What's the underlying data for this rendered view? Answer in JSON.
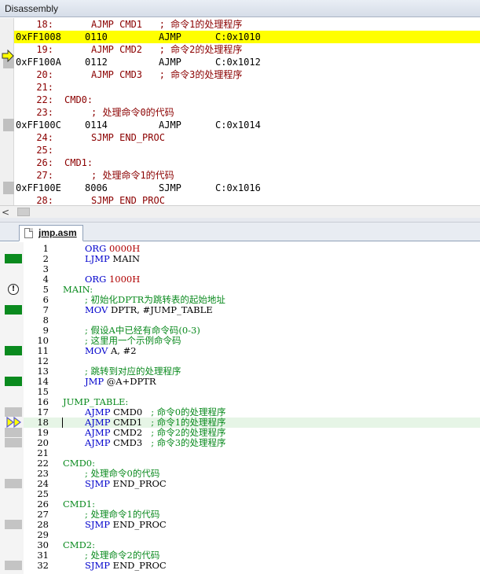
{
  "disassembly": {
    "title": "Disassembly",
    "lines": [
      {
        "kind": "src",
        "line": "18:",
        "text": "AJMP CMD1   ; 命令1的处理程序"
      },
      {
        "kind": "asm",
        "current": true,
        "addr": "0xFF1008",
        "opcode": "0110",
        "mnemonic": "AJMP",
        "operand": "C:0x1010"
      },
      {
        "kind": "src",
        "line": "19:",
        "text": "AJMP CMD2   ; 命令2的处理程序"
      },
      {
        "kind": "asm",
        "addr": "0xFF100A",
        "opcode": "0112",
        "mnemonic": "AJMP",
        "operand": "C:0x1012"
      },
      {
        "kind": "src",
        "line": "20:",
        "text": "AJMP CMD3   ; 命令3的处理程序"
      },
      {
        "kind": "src",
        "line": "21:",
        "text": ""
      },
      {
        "kind": "src",
        "line": "22:",
        "text": "CMD0:",
        "label": true
      },
      {
        "kind": "src",
        "line": "23:",
        "text": "; 处理命令0的代码"
      },
      {
        "kind": "asm",
        "addr": "0xFF100C",
        "opcode": "0114",
        "mnemonic": "AJMP",
        "operand": "C:0x1014"
      },
      {
        "kind": "src",
        "line": "24:",
        "text": "SJMP END_PROC"
      },
      {
        "kind": "src",
        "line": "25:",
        "text": ""
      },
      {
        "kind": "src",
        "line": "26:",
        "text": "CMD1:",
        "label": true
      },
      {
        "kind": "src",
        "line": "27:",
        "text": "; 处理命令1的代码"
      },
      {
        "kind": "asm",
        "addr": "0xFF100E",
        "opcode": "8006",
        "mnemonic": "SJMP",
        "operand": "C:0x1016"
      },
      {
        "kind": "src",
        "line": "28:",
        "text": "SJMP END_PROC"
      }
    ],
    "scroll_left_arrow": "<"
  },
  "editor": {
    "tab_label": "jmp.asm",
    "lines": [
      {
        "n": "1",
        "code": "ORG",
        "arg": "0000H",
        "argKind": "num",
        "mark": "none"
      },
      {
        "n": "2",
        "code": "LJMP",
        "arg": "MAIN",
        "mark": "green"
      },
      {
        "n": "3",
        "mark": "none"
      },
      {
        "n": "4",
        "code": "ORG",
        "arg": "1000H",
        "argKind": "num",
        "mark": "none"
      },
      {
        "n": "5",
        "label": "MAIN:",
        "mark": "warn"
      },
      {
        "n": "6",
        "comment": "; 初始化DPTR为跳转表的起始地址",
        "mark": "none"
      },
      {
        "n": "7",
        "code": "MOV",
        "arg": "DPTR, #JUMP_TABLE",
        "mark": "green"
      },
      {
        "n": "8",
        "mark": "none"
      },
      {
        "n": "9",
        "comment": "; 假设A中已经有命令码(0-3)",
        "mark": "none"
      },
      {
        "n": "10",
        "comment": "; 这里用一个示例命令码",
        "mark": "none"
      },
      {
        "n": "11",
        "code": "MOV",
        "arg": "A, #2",
        "mark": "green"
      },
      {
        "n": "12",
        "mark": "none"
      },
      {
        "n": "13",
        "comment": "; 跳转到对应的处理程序",
        "mark": "none"
      },
      {
        "n": "14",
        "code": "JMP",
        "arg": "@A+DPTR",
        "mark": "green"
      },
      {
        "n": "15",
        "mark": "none"
      },
      {
        "n": "16",
        "label": "JUMP_TABLE:",
        "mark": "none"
      },
      {
        "n": "17",
        "code": "AJMP",
        "arg": "CMD0",
        "comment": "; 命令0的处理程序",
        "mark": "gray"
      },
      {
        "n": "18",
        "code": "AJMP",
        "arg": "CMD1",
        "comment": "; 命令1的处理程序",
        "mark": "pc",
        "current": true
      },
      {
        "n": "19",
        "code": "AJMP",
        "arg": "CMD2",
        "comment": "; 命令2的处理程序",
        "mark": "gray"
      },
      {
        "n": "20",
        "code": "AJMP",
        "arg": "CMD3",
        "comment": "; 命令3的处理程序",
        "mark": "gray"
      },
      {
        "n": "21",
        "mark": "none"
      },
      {
        "n": "22",
        "label": "CMD0:",
        "mark": "none"
      },
      {
        "n": "23",
        "comment": "; 处理命令0的代码",
        "mark": "none"
      },
      {
        "n": "24",
        "code": "SJMP",
        "arg": "END_PROC",
        "mark": "gray"
      },
      {
        "n": "25",
        "mark": "none"
      },
      {
        "n": "26",
        "label": "CMD1:",
        "mark": "none"
      },
      {
        "n": "27",
        "comment": "; 处理命令1的代码",
        "mark": "none"
      },
      {
        "n": "28",
        "code": "SJMP",
        "arg": "END_PROC",
        "mark": "gray"
      },
      {
        "n": "29",
        "mark": "none"
      },
      {
        "n": "30",
        "label": "CMD2:",
        "mark": "none"
      },
      {
        "n": "31",
        "comment": "; 处理命令2的代码",
        "mark": "none"
      },
      {
        "n": "32",
        "code": "SJMP",
        "arg": "END_PROC",
        "mark": "gray"
      }
    ]
  },
  "colors": {
    "current_line_highlight": "#ffff00",
    "editor_current_line": "#e6f5e6",
    "executed_marker": "#0a8a1e",
    "keyword_blue": "#0000cc",
    "comment_green": "#0a8a1e",
    "number_red": "#b00000",
    "source_line_red": "#8b0000"
  },
  "icons": {
    "current_instruction": "yellow-arrow-icon",
    "warning": "warning-circle-icon",
    "program_counter": "double-yellow-arrow-icon",
    "file": "file-icon"
  }
}
